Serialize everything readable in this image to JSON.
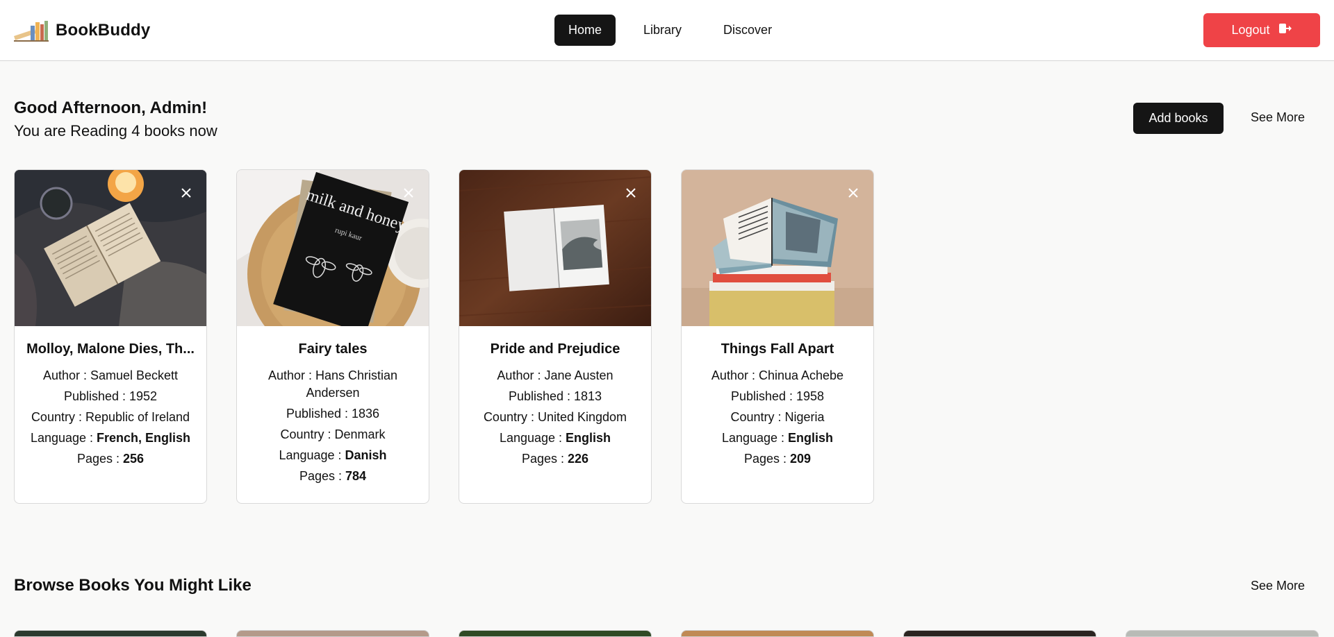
{
  "app": {
    "name": "BookBuddy"
  },
  "nav": {
    "items": [
      "Home",
      "Library",
      "Discover"
    ],
    "active": "Home"
  },
  "header": {
    "logout_label": "Logout"
  },
  "greeting": {
    "title": "Good Afternoon, Admin!",
    "subtitle": "You are Reading 4 books now",
    "add_books_label": "Add books",
    "see_more_label": "See More"
  },
  "labels": {
    "author": "Author : ",
    "published": "Published : ",
    "country": "Country : ",
    "language": "Language : ",
    "pages": "Pages : "
  },
  "reading": [
    {
      "title": "Molloy, Malone Dies, Th...",
      "author": "Samuel Beckett",
      "published": "1952",
      "country": "Republic of Ireland",
      "language": "French, English",
      "pages": "256",
      "image": "open-book-blanket-candle"
    },
    {
      "title": "Fairy tales",
      "author": "Hans Christian Andersen",
      "published": "1836",
      "country": "Denmark",
      "language": "Danish",
      "pages": "784",
      "image": "milk-and-honey-book"
    },
    {
      "title": "Pride and Prejudice",
      "author": "Jane Austen",
      "published": "1813",
      "country": "United Kingdom",
      "language": "English",
      "pages": "226",
      "image": "open-book-wave-photo"
    },
    {
      "title": "Things Fall Apart",
      "author": "Chinua Achebe",
      "published": "1958",
      "country": "Nigeria",
      "language": "English",
      "pages": "209",
      "image": "open-book-stack"
    }
  ],
  "cover_text": {
    "book_title": "milk and honey",
    "book_author": "rupi kaur"
  },
  "browse": {
    "title": "Browse Books You Might Like",
    "see_more_label": "See More",
    "thumb_colors": [
      "#2b3a2e",
      "#b49a8a",
      "#2f4a24",
      "#c08a55",
      "#2a2420",
      "#b8bbb6"
    ]
  },
  "colors": {
    "accent_dark": "#151515",
    "logout_red": "#ef4347"
  }
}
